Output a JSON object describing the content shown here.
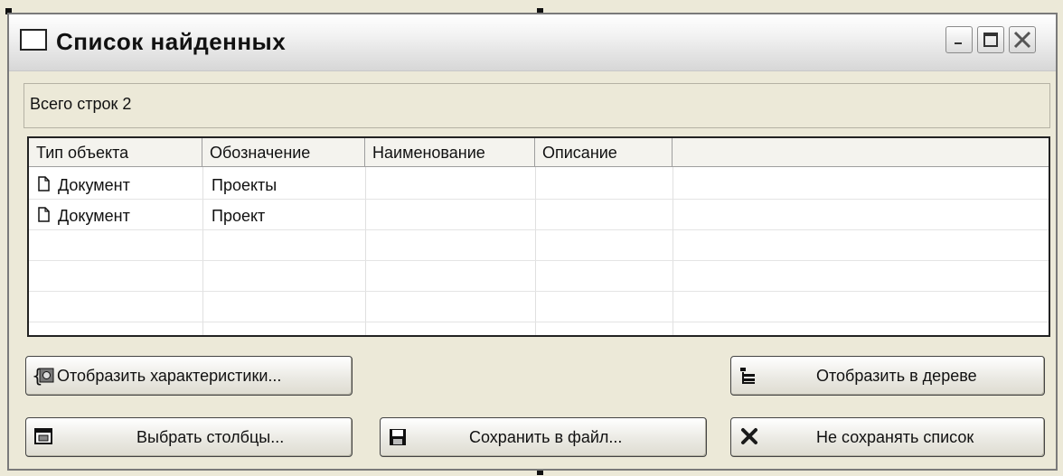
{
  "window": {
    "title": "Список найденных",
    "controls": {
      "minimize": "minimize-icon",
      "maximize": "maximize-icon",
      "close": "close-icon"
    }
  },
  "status": {
    "text": "Всего строк 2"
  },
  "table": {
    "columns": [
      "Тип объекта",
      "Обозначение",
      "Наименование",
      "Описание"
    ],
    "rows": [
      {
        "type": "Документ",
        "designation": "Проекты",
        "name": "",
        "description": ""
      },
      {
        "type": "Документ",
        "designation": "Проект",
        "name": "",
        "description": ""
      }
    ]
  },
  "buttons": {
    "show_characteristics": "Отобразить характеристики...",
    "choose_columns": "Выбрать столбцы...",
    "save_to_file": "Сохранить в файл...",
    "show_in_tree": "Отобразить в дереве",
    "dont_save_list": "Не сохранять список"
  },
  "colors": {
    "window_bg": "#ece9d8",
    "close_button": "#c75050",
    "close_icon_red": "#8b1a1a"
  }
}
